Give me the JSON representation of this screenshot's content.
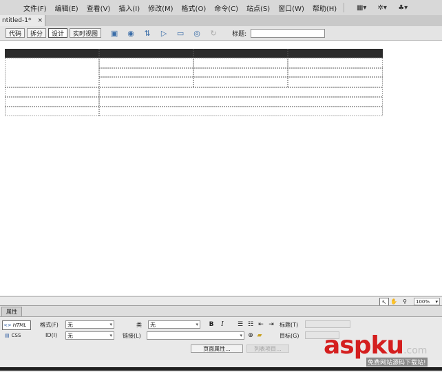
{
  "menubar": {
    "items": [
      "文件(F)",
      "编辑(E)",
      "查看(V)",
      "插入(I)",
      "修改(M)",
      "格式(O)",
      "命令(C)",
      "站点(S)",
      "窗口(W)",
      "帮助(H)"
    ],
    "icons": [
      "layout-icon",
      "settings-icon",
      "site-icon"
    ]
  },
  "document_tab": {
    "title": "ntitled-1*",
    "close": "×"
  },
  "toolbar": {
    "views": [
      "代码",
      "拆分",
      "设计",
      "实时视图"
    ],
    "active_view": "设计",
    "icons": [
      "multiscreen-icon",
      "preview-browser-icon",
      "file-management-icon",
      "live-code-icon",
      "visual-aids-icon",
      "check-page-icon",
      "refresh-icon"
    ],
    "title_label": "标题:",
    "title_value": ""
  },
  "status": {
    "zoom": "100%"
  },
  "properties": {
    "tab": "属性",
    "html_mode": "HTML",
    "css_mode": "CSS",
    "format_label": "格式(F)",
    "format_value": "无",
    "class_label": "类",
    "class_value": "无",
    "id_label": "ID(I)",
    "id_value": "无",
    "link_label": "链接(L)",
    "link_value": "",
    "bold": "B",
    "italic": "I",
    "title_label": "标题(T)",
    "target_label": "目标(G)",
    "page_props_button": "页面属性...",
    "list_item_button": "列表项目..."
  },
  "watermark": {
    "brand": "aspku",
    "suffix": ".com",
    "tagline": "免费网站源码下载站!"
  }
}
